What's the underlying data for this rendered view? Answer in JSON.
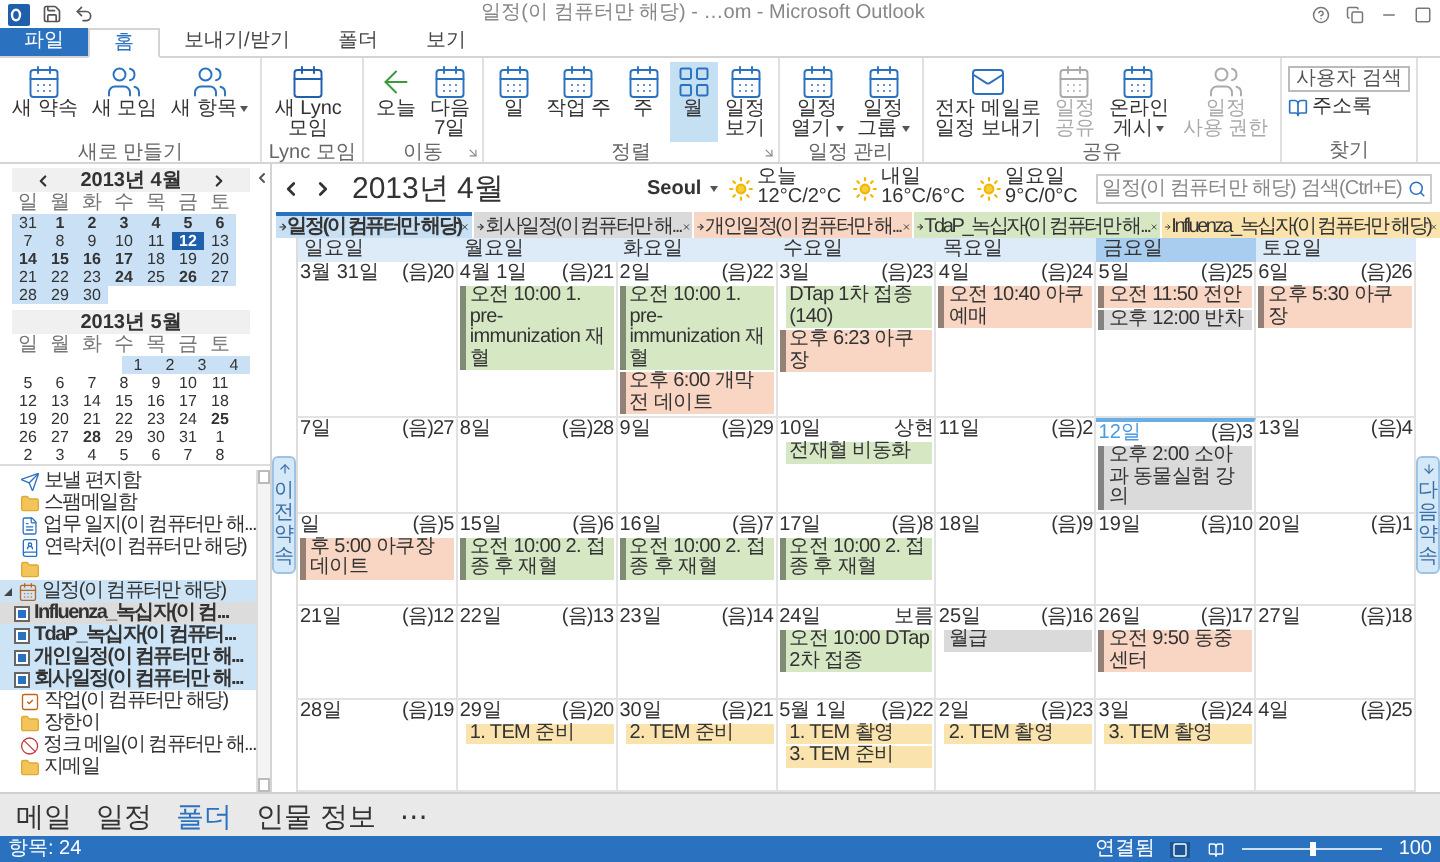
{
  "window": {
    "title": "일정(이 컴퓨터만 해당) - …om - Microsoft Outlook"
  },
  "menu_tabs": [
    {
      "label": "파일",
      "kind": "file",
      "selected": false
    },
    {
      "label": "홈",
      "kind": "tab",
      "selected": true
    },
    {
      "label": "보내기/받기",
      "kind": "tab",
      "selected": false
    },
    {
      "label": "폴더",
      "kind": "tab",
      "selected": false
    },
    {
      "label": "보기",
      "kind": "tab",
      "selected": false
    }
  ],
  "ribbon": [
    {
      "label": "새로 만들기",
      "kind": "buttons",
      "launcher": false,
      "buttons": [
        {
          "lines": [
            "새 약속"
          ],
          "kind": "calendar",
          "selected": false,
          "disabled": false,
          "dropdown": false
        },
        {
          "lines": [
            "새 모임"
          ],
          "kind": "people",
          "selected": false,
          "disabled": false,
          "dropdown": false
        },
        {
          "lines": [
            "새 항목"
          ],
          "kind": "people",
          "selected": false,
          "disabled": false,
          "dropdown": true
        }
      ]
    },
    {
      "label": "Lync 모임",
      "kind": "buttons",
      "launcher": false,
      "buttons": [
        {
          "lines": [
            "새 Lync",
            "모임"
          ],
          "kind": "lync",
          "selected": false,
          "disabled": false,
          "dropdown": false
        }
      ]
    },
    {
      "label": "이동",
      "kind": "buttons",
      "launcher": true,
      "buttons": [
        {
          "lines": [
            "오늘"
          ],
          "kind": "arrow",
          "selected": false,
          "disabled": false,
          "dropdown": false
        },
        {
          "lines": [
            "다음",
            "7일"
          ],
          "kind": "calendar",
          "selected": false,
          "disabled": false,
          "dropdown": false
        }
      ]
    },
    {
      "label": "정렬",
      "kind": "buttons",
      "launcher": true,
      "buttons": [
        {
          "lines": [
            "일"
          ],
          "kind": "calendar",
          "selected": false,
          "disabled": false,
          "dropdown": false
        },
        {
          "lines": [
            "작업 주"
          ],
          "kind": "calendar",
          "selected": false,
          "disabled": false,
          "dropdown": false
        },
        {
          "lines": [
            "주"
          ],
          "kind": "calendar",
          "selected": false,
          "disabled": false,
          "dropdown": false
        },
        {
          "lines": [
            "월"
          ],
          "kind": "grid",
          "selected": true,
          "disabled": false,
          "dropdown": false
        },
        {
          "lines": [
            "일정",
            "보기"
          ],
          "kind": "calendar",
          "selected": false,
          "disabled": false,
          "dropdown": false
        }
      ]
    },
    {
      "label": "일정 관리",
      "kind": "buttons",
      "launcher": false,
      "buttons": [
        {
          "lines": [
            "일정",
            "열기"
          ],
          "kind": "calendar",
          "selected": false,
          "disabled": false,
          "dropdown": true
        },
        {
          "lines": [
            "일정",
            "그룹"
          ],
          "kind": "calendar",
          "selected": false,
          "disabled": false,
          "dropdown": true
        }
      ]
    },
    {
      "label": "공유",
      "kind": "buttons",
      "launcher": false,
      "buttons": [
        {
          "lines": [
            "전자 메일로",
            "일정 보내기"
          ],
          "kind": "mail",
          "selected": false,
          "disabled": false,
          "dropdown": false
        },
        {
          "lines": [
            "일정",
            "공유"
          ],
          "kind": "calendar",
          "selected": false,
          "disabled": true,
          "dropdown": false
        },
        {
          "lines": [
            "온라인",
            "게시"
          ],
          "kind": "calendar",
          "selected": false,
          "disabled": false,
          "dropdown": true
        },
        {
          "lines": [
            "일정",
            "사용 권한"
          ],
          "kind": "people",
          "selected": false,
          "disabled": true,
          "dropdown": false
        }
      ]
    },
    {
      "label": "찾기",
      "kind": "find",
      "field": {
        "placeholder": "사용자 검색"
      },
      "link": "주소록"
    }
  ],
  "mini_calendars": [
    {
      "title": "2013년 4월",
      "arrows": true,
      "weekdays": [
        "일",
        "월",
        "화",
        "수",
        "목",
        "금",
        "토"
      ],
      "weeks": [
        [
          {
            "day": "31",
            "in_range": true,
            "bold": false,
            "selected": false
          },
          {
            "day": "1",
            "in_range": true,
            "bold": true,
            "selected": false
          },
          {
            "day": "2",
            "in_range": true,
            "bold": true,
            "selected": false
          },
          {
            "day": "3",
            "in_range": true,
            "bold": true,
            "selected": false
          },
          {
            "day": "4",
            "in_range": true,
            "bold": true,
            "selected": false
          },
          {
            "day": "5",
            "in_range": true,
            "bold": true,
            "selected": false
          },
          {
            "day": "6",
            "in_range": true,
            "bold": true,
            "selected": false
          }
        ],
        [
          {
            "day": "7",
            "in_range": true,
            "bold": false,
            "selected": false
          },
          {
            "day": "8",
            "in_range": true,
            "bold": false,
            "selected": false
          },
          {
            "day": "9",
            "in_range": true,
            "bold": false,
            "selected": false
          },
          {
            "day": "10",
            "in_range": true,
            "bold": false,
            "selected": false
          },
          {
            "day": "11",
            "in_range": true,
            "bold": false,
            "selected": false
          },
          {
            "day": "12",
            "in_range": true,
            "bold": true,
            "selected": true
          },
          {
            "day": "13",
            "in_range": true,
            "bold": false,
            "selected": false
          }
        ],
        [
          {
            "day": "14",
            "in_range": true,
            "bold": true,
            "selected": false
          },
          {
            "day": "15",
            "in_range": true,
            "bold": true,
            "selected": false
          },
          {
            "day": "16",
            "in_range": true,
            "bold": true,
            "selected": false
          },
          {
            "day": "17",
            "in_range": true,
            "bold": true,
            "selected": false
          },
          {
            "day": "18",
            "in_range": true,
            "bold": false,
            "selected": false
          },
          {
            "day": "19",
            "in_range": true,
            "bold": false,
            "selected": false
          },
          {
            "day": "20",
            "in_range": true,
            "bold": false,
            "selected": false
          }
        ],
        [
          {
            "day": "21",
            "in_range": true,
            "bold": false,
            "selected": false
          },
          {
            "day": "22",
            "in_range": true,
            "bold": false,
            "selected": false
          },
          {
            "day": "23",
            "in_range": true,
            "bold": false,
            "selected": false
          },
          {
            "day": "24",
            "in_range": true,
            "bold": true,
            "selected": false
          },
          {
            "day": "25",
            "in_range": true,
            "bold": false,
            "selected": false
          },
          {
            "day": "26",
            "in_range": true,
            "bold": true,
            "selected": false
          },
          {
            "day": "27",
            "in_range": true,
            "bold": false,
            "selected": false
          }
        ],
        [
          {
            "day": "28",
            "in_range": true,
            "bold": false,
            "selected": false
          },
          {
            "day": "29",
            "in_range": true,
            "bold": false,
            "selected": false
          },
          {
            "day": "30",
            "in_range": true,
            "bold": false,
            "selected": false
          }
        ]
      ]
    },
    {
      "title": "2013년 5월",
      "arrows": false,
      "weekdays": [
        "일",
        "월",
        "화",
        "수",
        "목",
        "금",
        "토"
      ],
      "weeks": [
        [
          {
            "day": "1",
            "in_range": true,
            "bold": false,
            "selected": false
          },
          {
            "day": "2",
            "in_range": true,
            "bold": false,
            "selected": false
          },
          {
            "day": "3",
            "in_range": true,
            "bold": false,
            "selected": false
          },
          {
            "day": "4",
            "in_range": true,
            "bold": false,
            "selected": false
          }
        ],
        [
          {
            "day": "5",
            "in_range": false,
            "bold": false,
            "selected": false
          },
          {
            "day": "6",
            "in_range": false,
            "bold": false,
            "selected": false
          },
          {
            "day": "7",
            "in_range": false,
            "bold": false,
            "selected": false
          },
          {
            "day": "8",
            "in_range": false,
            "bold": false,
            "selected": false
          },
          {
            "day": "9",
            "in_range": false,
            "bold": false,
            "selected": false
          },
          {
            "day": "10",
            "in_range": false,
            "bold": false,
            "selected": false
          },
          {
            "day": "11",
            "in_range": false,
            "bold": false,
            "selected": false
          }
        ],
        [
          {
            "day": "12",
            "in_range": false,
            "bold": false,
            "selected": false
          },
          {
            "day": "13",
            "in_range": false,
            "bold": false,
            "selected": false
          },
          {
            "day": "14",
            "in_range": false,
            "bold": false,
            "selected": false
          },
          {
            "day": "15",
            "in_range": false,
            "bold": false,
            "selected": false
          },
          {
            "day": "16",
            "in_range": false,
            "bold": false,
            "selected": false
          },
          {
            "day": "17",
            "in_range": false,
            "bold": false,
            "selected": false
          },
          {
            "day": "18",
            "in_range": false,
            "bold": false,
            "selected": false
          }
        ],
        [
          {
            "day": "19",
            "in_range": false,
            "bold": false,
            "selected": false
          },
          {
            "day": "20",
            "in_range": false,
            "bold": false,
            "selected": false
          },
          {
            "day": "21",
            "in_range": false,
            "bold": false,
            "selected": false
          },
          {
            "day": "22",
            "in_range": false,
            "bold": false,
            "selected": false
          },
          {
            "day": "23",
            "in_range": false,
            "bold": false,
            "selected": false
          },
          {
            "day": "24",
            "in_range": false,
            "bold": false,
            "selected": false
          },
          {
            "day": "25",
            "in_range": false,
            "bold": true,
            "selected": false
          }
        ],
        [
          {
            "day": "26",
            "in_range": false,
            "bold": false,
            "selected": false
          },
          {
            "day": "27",
            "in_range": false,
            "bold": false,
            "selected": false
          },
          {
            "day": "28",
            "in_range": false,
            "bold": true,
            "selected": false
          },
          {
            "day": "29",
            "in_range": false,
            "bold": false,
            "selected": false
          },
          {
            "day": "30",
            "in_range": false,
            "bold": false,
            "selected": false
          },
          {
            "day": "31",
            "in_range": false,
            "bold": false,
            "selected": false
          },
          {
            "day": "1",
            "in_range": false,
            "bold": false,
            "selected": false
          }
        ],
        [
          {
            "day": "2",
            "in_range": false,
            "bold": false,
            "selected": false
          },
          {
            "day": "3",
            "in_range": false,
            "bold": false,
            "selected": false
          },
          {
            "day": "4",
            "in_range": false,
            "bold": false,
            "selected": false
          },
          {
            "day": "5",
            "in_range": false,
            "bold": false,
            "selected": false
          },
          {
            "day": "6",
            "in_range": false,
            "bold": false,
            "selected": false
          },
          {
            "day": "7",
            "in_range": false,
            "bold": false,
            "selected": false
          },
          {
            "day": "8",
            "in_range": false,
            "bold": false,
            "selected": false
          }
        ]
      ]
    }
  ],
  "folders": [
    {
      "label": "보낼 편지함",
      "kind": "outbox",
      "selected": false
    },
    {
      "label": "스팸메일함",
      "kind": "folder",
      "selected": false
    },
    {
      "label": "업무 일지(이 컴퓨터만 해...",
      "kind": "journal",
      "selected": false
    },
    {
      "label": "연락처(이 컴퓨터만 해당)",
      "kind": "contacts",
      "selected": false
    },
    {
      "kind": "folder",
      "selected": false
    },
    {
      "label": "일정(이 컴퓨터만 해당)",
      "kind": "calendar",
      "selected": true,
      "expanded": true,
      "children": [
        {
          "label": "Influenza_녹십자(이 컴...",
          "checked": true,
          "focused": true
        },
        {
          "label": "TdaP_녹십자(이 컴퓨터...",
          "checked": true,
          "focused": false
        },
        {
          "label": "개인일정(이 컴퓨터만 해...",
          "checked": true,
          "focused": false
        },
        {
          "label": "회사일정(이 컴퓨터만 해...",
          "checked": true,
          "focused": false
        }
      ]
    },
    {
      "label": "작업(이 컴퓨터만 해당)",
      "kind": "tasks",
      "selected": false
    },
    {
      "label": "장한이",
      "kind": "folder",
      "selected": false
    },
    {
      "label": "정크 메일(이 컴퓨터만 해...",
      "kind": "junk",
      "selected": false
    },
    {
      "label": "지메일",
      "kind": "folder",
      "selected": false
    }
  ],
  "calendar": {
    "month": "2013년 4월",
    "location": "Seoul",
    "weather": [
      {
        "day": "오늘",
        "temp": "12°C/2°C"
      },
      {
        "day": "내일",
        "temp": "16°C/6°C"
      },
      {
        "day": "일요일",
        "temp": "9°C/0°C"
      }
    ],
    "search": {
      "placeholder": "일정(이 컴퓨터만 해당) 검색(Ctrl+E)"
    },
    "tabs": [
      {
        "label": "일정(이 컴퓨터만 해당)",
        "color": "#c7e0f4",
        "selected": true
      },
      {
        "label": "회사일정(이 컴퓨터만 해...",
        "color": "#dadada",
        "selected": false
      },
      {
        "label": "개인일정(이 컴퓨터만 해...",
        "color": "#f9d6c3",
        "selected": false
      },
      {
        "label": "TdaP_녹십자(이 컴퓨터만 해...",
        "color": "#d6e7c4",
        "selected": false
      },
      {
        "label": "Influenza_녹십자(이 컴퓨터만 해당)",
        "color": "#fae3ad",
        "selected": false
      }
    ],
    "prev_tab": "이전 약속",
    "next_tab": "다음 약속",
    "weekdays": [
      {
        "label": "일요일",
        "selected": false
      },
      {
        "label": "월요일",
        "selected": false
      },
      {
        "label": "화요일",
        "selected": false
      },
      {
        "label": "수요일",
        "selected": false
      },
      {
        "label": "목요일",
        "selected": false
      },
      {
        "label": "금요일",
        "selected": true
      },
      {
        "label": "토요일",
        "selected": false
      }
    ],
    "weeks": [
      [
        {
          "date": "3월 31일",
          "lunar": "(음)20",
          "today": false
        },
        {
          "date": "4월 1일",
          "lunar": "(음)21",
          "today": false,
          "events": [
            {
              "text": "오전 10:00 1. pre-immunization 재혈",
              "color": "#d6e7c4",
              "free": false
            }
          ]
        },
        {
          "date": "2일",
          "lunar": "(음)22",
          "today": false,
          "events": [
            {
              "text": "오전 10:00 1. pre-immunization 재혈",
              "color": "#d6e7c4",
              "free": false
            },
            {
              "text": "오후 6:00 개막전 데이트",
              "color": "#f9d6c3",
              "free": false
            }
          ]
        },
        {
          "date": "3일",
          "lunar": "(음)23",
          "today": false,
          "events": [
            {
              "text": "DTap 1차 접종(140)",
              "color": "#d6e7c4",
              "free": true
            },
            {
              "text": "오후 6:23 아쿠장",
              "color": "#f9d6c3",
              "free": false
            }
          ]
        },
        {
          "date": "4일",
          "lunar": "(음)24",
          "today": false,
          "events": [
            {
              "text": "오전 10:40 아쿠예매",
              "color": "#f9d6c3",
              "free": false
            }
          ]
        },
        {
          "date": "5일",
          "lunar": "(음)25",
          "today": false,
          "events": [
            {
              "text": "오전 11:50 전안",
              "color": "#f9d6c3",
              "free": false
            },
            {
              "text": "오후 12:00 반차",
              "color": "#dadada",
              "free": false
            }
          ]
        },
        {
          "date": "6일",
          "lunar": "(음)26",
          "today": false,
          "events": [
            {
              "text": "오후 5:30 아쿠장",
              "color": "#f9d6c3",
              "free": false
            }
          ]
        }
      ],
      [
        {
          "date": "7일",
          "lunar": "(음)27",
          "today": false
        },
        {
          "date": "8일",
          "lunar": "(음)28",
          "today": false
        },
        {
          "date": "9일",
          "lunar": "(음)29",
          "today": false
        },
        {
          "date": "10일",
          "lunar": "상현",
          "today": false,
          "events": [
            {
              "text": "전재혈 비동화",
              "color": "#d6e7c4",
              "free": true
            }
          ]
        },
        {
          "date": "11일",
          "lunar": "(음)2",
          "today": false
        },
        {
          "date": "12일",
          "lunar": "(음)3",
          "today": true,
          "events": [
            {
              "text": "오후 2:00 소아과 동물실험 강의",
              "color": "#dadada",
              "free": false
            }
          ]
        },
        {
          "date": "13일",
          "lunar": "(음)4",
          "today": false
        }
      ],
      [
        {
          "date": "일",
          "lunar": "(음)5",
          "today": false,
          "events": [
            {
              "text": "후 5:00 아쿠장 데이트",
              "color": "#f9d6c3",
              "free": false
            }
          ]
        },
        {
          "date": "15일",
          "lunar": "(음)6",
          "today": false,
          "events": [
            {
              "text": "오전 10:00 2. 접종 후 재혈",
              "color": "#d6e7c4",
              "free": false
            }
          ]
        },
        {
          "date": "16일",
          "lunar": "(음)7",
          "today": false,
          "events": [
            {
              "text": "오전 10:00 2. 접종 후 재혈",
              "color": "#d6e7c4",
              "free": false
            }
          ]
        },
        {
          "date": "17일",
          "lunar": "(음)8",
          "today": false,
          "events": [
            {
              "text": "오전 10:00 2. 접종 후 재혈",
              "color": "#d6e7c4",
              "free": false
            }
          ]
        },
        {
          "date": "18일",
          "lunar": "(음)9",
          "today": false
        },
        {
          "date": "19일",
          "lunar": "(음)10",
          "today": false
        },
        {
          "date": "20일",
          "lunar": "(음)1",
          "today": false
        }
      ],
      [
        {
          "date": "21일",
          "lunar": "(음)12",
          "today": false
        },
        {
          "date": "22일",
          "lunar": "(음)13",
          "today": false
        },
        {
          "date": "23일",
          "lunar": "(음)14",
          "today": false
        },
        {
          "date": "24일",
          "lunar": "보름",
          "today": false,
          "events": [
            {
              "text": "오전 10:00 DTap 2차 접종",
              "color": "#d6e7c4",
              "free": false
            }
          ]
        },
        {
          "date": "25일",
          "lunar": "(음)16",
          "today": false,
          "events": [
            {
              "text": "월급",
              "color": "#dadada",
              "free": true
            }
          ]
        },
        {
          "date": "26일",
          "lunar": "(음)17",
          "today": false,
          "events": [
            {
              "text": "오전 9:50 동중센터",
              "color": "#f9d6c3",
              "free": false
            }
          ]
        },
        {
          "date": "27일",
          "lunar": "(음)18",
          "today": false
        }
      ],
      [
        {
          "date": "28일",
          "lunar": "(음)19",
          "today": false
        },
        {
          "date": "29일",
          "lunar": "(음)20",
          "today": false,
          "events": [
            {
              "text": "1. TEM 준비",
              "color": "#fae3ad",
              "free": true
            }
          ]
        },
        {
          "date": "30일",
          "lunar": "(음)21",
          "today": false,
          "events": [
            {
              "text": "2. TEM 준비",
              "color": "#fae3ad",
              "free": true
            }
          ]
        },
        {
          "date": "5월 1일",
          "lunar": "(음)22",
          "today": false,
          "events": [
            {
              "text": "1. TEM 촬영",
              "color": "#fae3ad",
              "free": true
            },
            {
              "text": "3. TEM 준비",
              "color": "#fae3ad",
              "free": true
            }
          ]
        },
        {
          "date": "2일",
          "lunar": "(음)23",
          "today": false,
          "events": [
            {
              "text": "2. TEM 촬영",
              "color": "#fae3ad",
              "free": true
            }
          ]
        },
        {
          "date": "3일",
          "lunar": "(음)24",
          "today": false,
          "events": [
            {
              "text": "3. TEM 촬영",
              "color": "#fae3ad",
              "free": true
            }
          ]
        },
        {
          "date": "4일",
          "lunar": "(음)25",
          "today": false
        }
      ]
    ]
  },
  "nav": {
    "items": [
      {
        "label": "메일",
        "selected": false
      },
      {
        "label": "일정",
        "selected": false
      },
      {
        "label": "폴더",
        "selected": true
      },
      {
        "label": "인물 정보",
        "selected": false
      }
    ],
    "more": "⋯"
  },
  "status_bar": {
    "items": "항목: 24",
    "connection": "연결됨",
    "views": [
      {
        "selected": true
      },
      {
        "selected": false
      }
    ],
    "zoom": {
      "level": 0.5
    },
    "zoom_text": "100"
  }
}
